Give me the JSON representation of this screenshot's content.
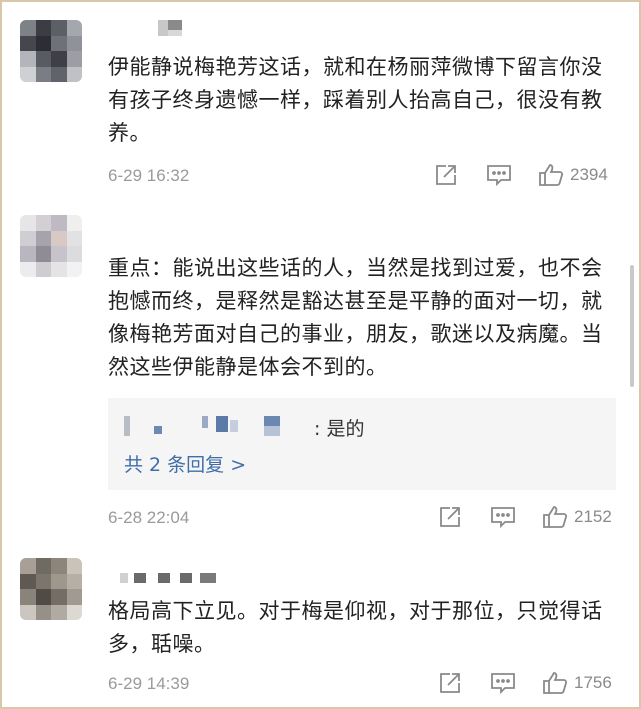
{
  "comments": [
    {
      "text": "伊能静说梅艳芳这话，就和在杨丽萍微博下留言你没有孩子终身遗憾一样，踩着别人抬高自己，很没有教养。",
      "time": "6-29 16:32",
      "likes": "2394"
    },
    {
      "text": "重点：能说出这些话的人，当然是找到过爱，也不会抱憾而终，是释然是豁达甚至是平静的面对一切，就像梅艳芳面对自己的事业，朋友，歌迷以及病魔。当然这些伊能静是体会不到的。",
      "reply_suffix": ": 是的",
      "reply_more": "共 2 条回复 >",
      "time": "6-28 22:04",
      "likes": "2152"
    },
    {
      "text": "格局高下立见。对于梅是仰视，对于那位，只觉得话多，聒噪。",
      "time": "6-29 14:39",
      "likes": "1756"
    }
  ],
  "icons": {
    "share": "share-icon",
    "comment": "comment-icon",
    "like": "thumbs-up-icon"
  },
  "colors": {
    "text": "#222222",
    "meta": "#9a9a9a",
    "link": "#3f6ea8",
    "reply_bg": "#f5f5f5",
    "frame": "#d8c8a8"
  }
}
